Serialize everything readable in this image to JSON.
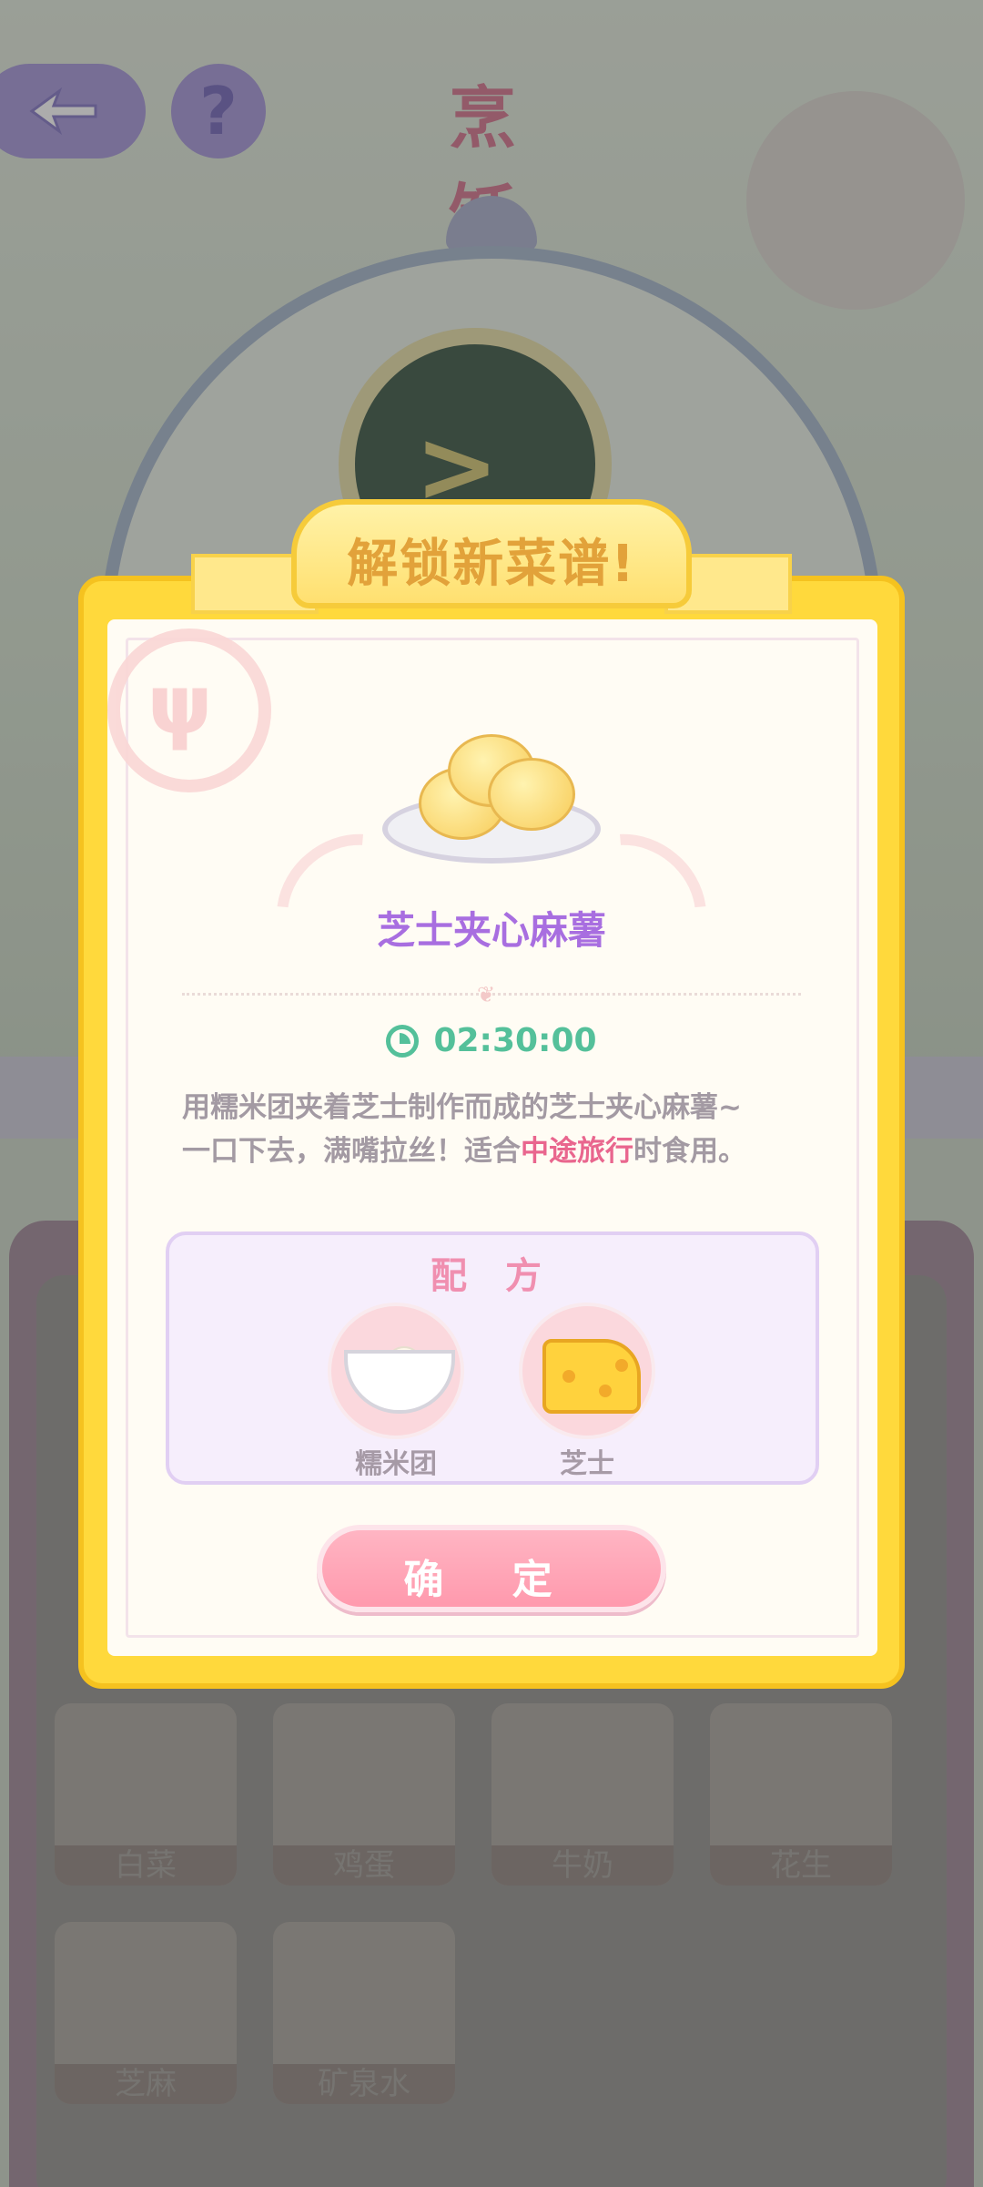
{
  "screen": {
    "title": "烹 饪"
  },
  "ingredients_grid": [
    {
      "label": "白菜"
    },
    {
      "label": "鸡蛋"
    },
    {
      "label": "牛奶"
    },
    {
      "label": "花生"
    },
    {
      "label": "芝麻"
    },
    {
      "label": "矿泉水"
    }
  ],
  "modal": {
    "banner": "解锁新菜谱!",
    "dish_name": "芝士夹心麻薯",
    "timer": "02:30:00",
    "description_line1": "用糯米团夹着芝士制作而成的芝士夹心麻薯~",
    "description_line2_before": "一口下去，满嘴拉丝！适合",
    "description_highlight": "中途旅行",
    "description_line2_after": "时食用。",
    "recipe_title": "配 方",
    "recipe_items": [
      {
        "label": "糯米团",
        "icon": "rice-ball-bowl-icon"
      },
      {
        "label": "芝士",
        "icon": "cheese-icon"
      }
    ],
    "confirm_label": "确 定"
  },
  "colors": {
    "modal_border": "#ffd93c",
    "dish_name": "#a86ee0",
    "timer": "#54c09a",
    "highlight": "#e9668e",
    "confirm": "#ff99ad"
  }
}
